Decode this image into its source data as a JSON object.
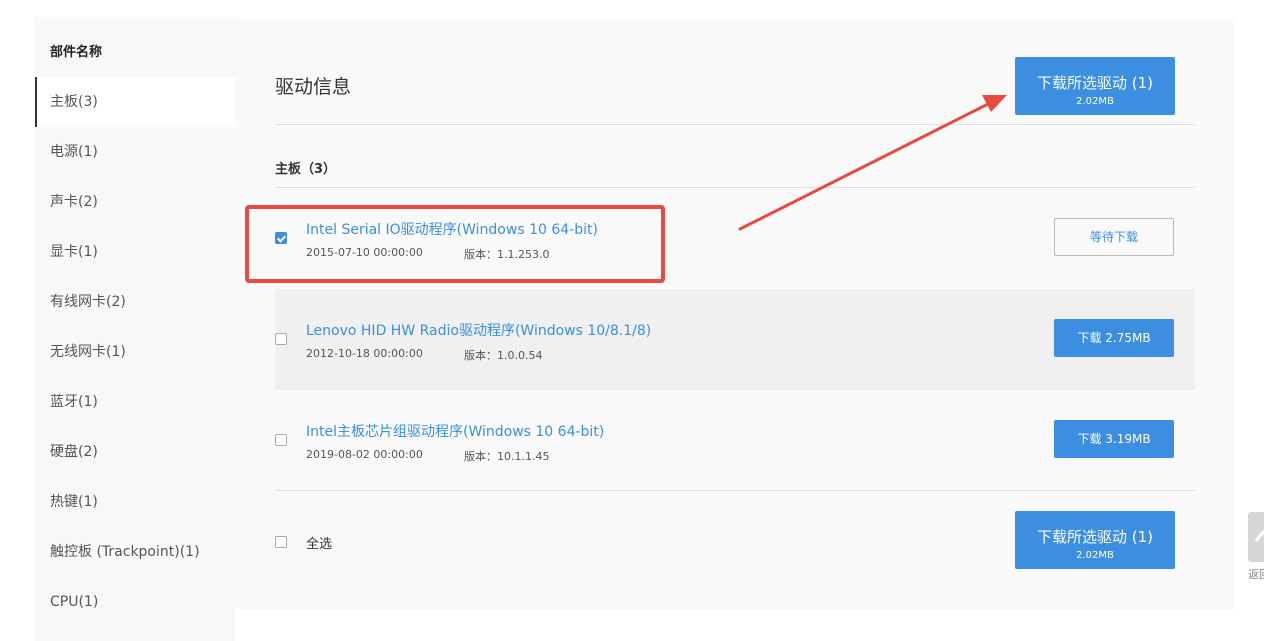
{
  "sidebar": {
    "heading": "部件名称",
    "items": [
      {
        "label": "主板(3)",
        "active": true
      },
      {
        "label": "电源(1)"
      },
      {
        "label": "声卡(2)"
      },
      {
        "label": "显卡(1)"
      },
      {
        "label": "有线网卡(2)"
      },
      {
        "label": "无线网卡(1)"
      },
      {
        "label": "蓝牙(1)"
      },
      {
        "label": "硬盘(2)"
      },
      {
        "label": "热键(1)"
      },
      {
        "label": "触控板 (Trackpoint)(1)"
      },
      {
        "label": "CPU(1)"
      }
    ]
  },
  "main": {
    "title": "驱动信息",
    "download_selected": {
      "label": "下载所选驱动 (1)",
      "size": "2.02MB"
    },
    "section": "主板（3）",
    "drivers": [
      {
        "name": "Intel Serial IO驱动程序(Windows 10 64-bit)",
        "date": "2015-07-10 00:00:00",
        "version": "版本：1.1.253.0",
        "checked": true,
        "button": "等待下载",
        "button_style": "wait"
      },
      {
        "name": "Lenovo HID HW Radio驱动程序(Windows 10/8.1/8)",
        "date": "2012-10-18 00:00:00",
        "version": "版本：1.0.0.54",
        "checked": false,
        "button": "下载 2.75MB",
        "button_style": "dl"
      },
      {
        "name": "Intel主板芯片组驱动程序(Windows 10 64-bit)",
        "date": "2019-08-02 00:00:00",
        "version": "版本：10.1.1.45",
        "checked": false,
        "button": "下载 3.19MB",
        "button_style": "dl"
      }
    ],
    "select_all": "全选",
    "download_selected_bottom": {
      "label": "下载所选驱动 (1)",
      "size": "2.02MB"
    }
  },
  "back_to_top": {
    "label": "返回"
  },
  "colors": {
    "accent": "#3b8ee0",
    "annotation": "#e84a3f"
  }
}
